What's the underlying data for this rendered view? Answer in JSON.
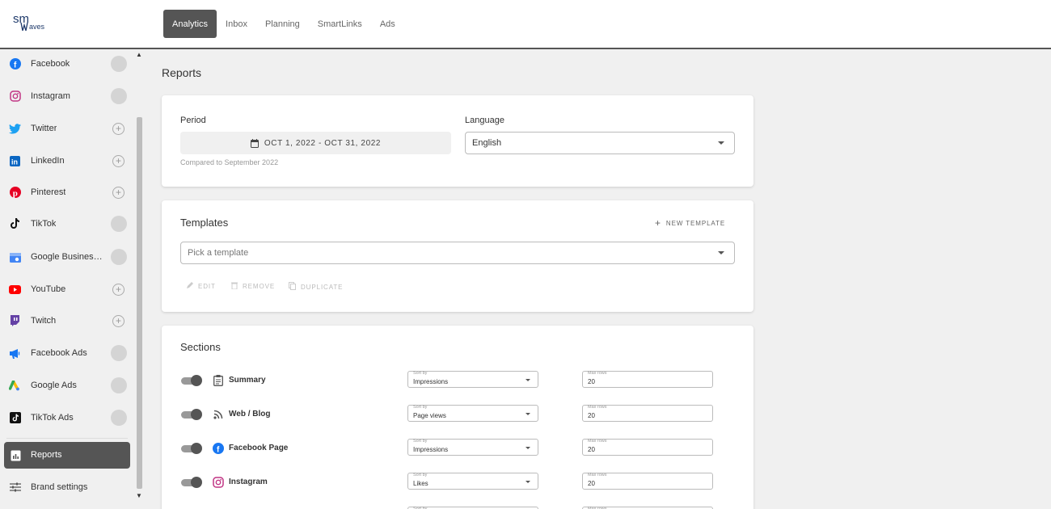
{
  "app": {
    "logo_text_top": "sm",
    "logo_text_bottom": "waves"
  },
  "nav": {
    "tabs": [
      {
        "label": "Analytics"
      },
      {
        "label": "Inbox"
      },
      {
        "label": "Planning"
      },
      {
        "label": "SmartLinks"
      },
      {
        "label": "Ads"
      }
    ]
  },
  "sidebar": {
    "items": [
      {
        "label": "Facebook",
        "icon": "facebook-icon",
        "connected": true
      },
      {
        "label": "Instagram",
        "icon": "instagram-icon",
        "connected": true
      },
      {
        "label": "Twitter",
        "icon": "twitter-icon",
        "connected": false
      },
      {
        "label": "LinkedIn",
        "icon": "linkedin-icon",
        "connected": false
      },
      {
        "label": "Pinterest",
        "icon": "pinterest-icon",
        "connected": false
      },
      {
        "label": "TikTok",
        "icon": "tiktok-icon",
        "connected": true
      },
      {
        "label": "Google Business...",
        "icon": "google-business-icon",
        "connected": true
      },
      {
        "label": "YouTube",
        "icon": "youtube-icon",
        "connected": false
      },
      {
        "label": "Twitch",
        "icon": "twitch-icon",
        "connected": false
      },
      {
        "label": "Facebook Ads",
        "icon": "facebook-ads-icon",
        "connected": true
      },
      {
        "label": "Google Ads",
        "icon": "google-ads-icon",
        "connected": true
      },
      {
        "label": "TikTok Ads",
        "icon": "tiktok-ads-icon",
        "connected": true
      }
    ],
    "reports_label": "Reports",
    "brand_settings_label": "Brand settings"
  },
  "main": {
    "title": "Reports",
    "period": {
      "label": "Period",
      "range": "OCT 1, 2022 - OCT 31, 2022",
      "compared": "Compared to September 2022"
    },
    "language": {
      "label": "Language",
      "value": "English"
    },
    "templates": {
      "title": "Templates",
      "new_label": "NEW TEMPLATE",
      "placeholder": "Pick a template",
      "edit_label": "EDIT",
      "remove_label": "REMOVE",
      "duplicate_label": "DUPLICATE"
    },
    "sections": {
      "title": "Sections",
      "sort_label": "Sort by",
      "max_label": "Max rows",
      "rows": [
        {
          "label": "Summary",
          "icon": "clipboard-icon",
          "sort": "Impressions",
          "max": "20"
        },
        {
          "label": "Web / Blog",
          "icon": "rss-icon",
          "sort": "Page views",
          "max": "20"
        },
        {
          "label": "Facebook Page",
          "icon": "facebook-icon",
          "sort": "Impressions",
          "max": "20"
        },
        {
          "label": "Instagram",
          "icon": "instagram-icon",
          "sort": "Likes",
          "max": "20"
        }
      ]
    }
  },
  "colors": {
    "facebook": "#1877f2",
    "instagram": "#c13584",
    "twitter": "#1da1f2",
    "linkedin": "#0a66c2",
    "pinterest": "#e60023",
    "youtube": "#ff0000",
    "twitch": "#6441a5",
    "google_ads_green": "#34a853",
    "google_ads_yellow": "#fbbc04",
    "active_tab": "#555555"
  }
}
